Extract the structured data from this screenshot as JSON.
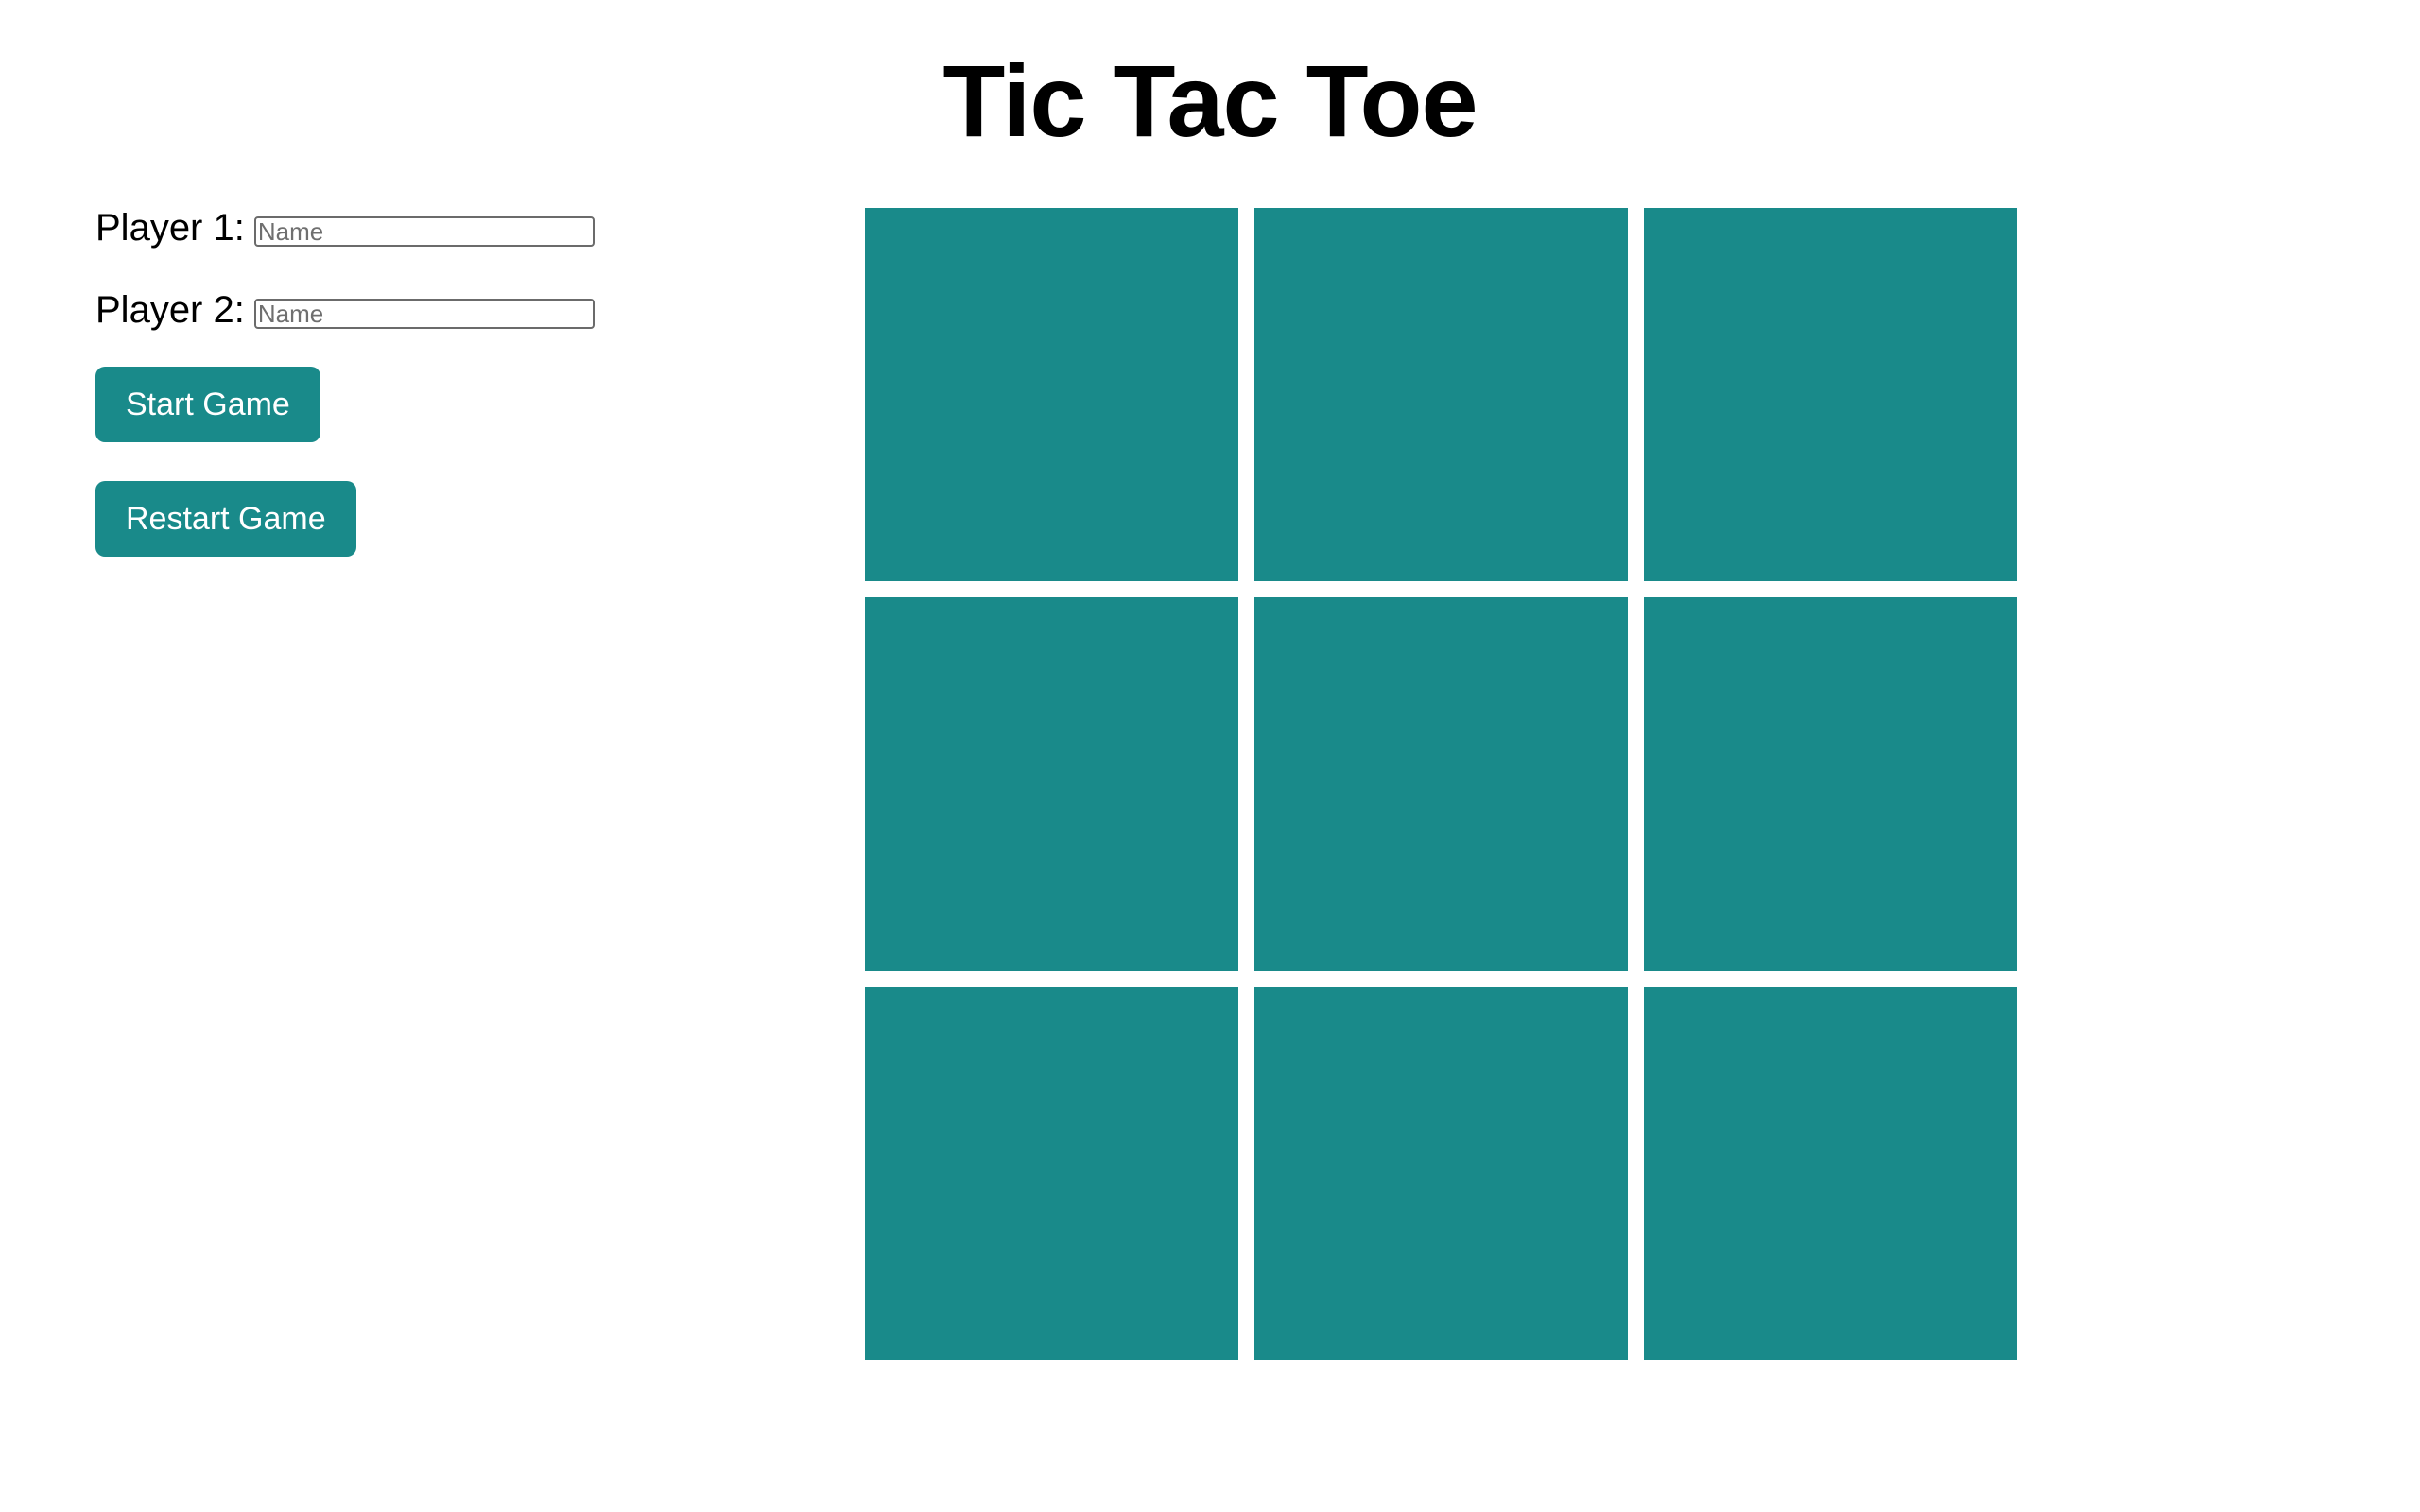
{
  "page": {
    "title": "Tic Tac Toe"
  },
  "players": [
    {
      "label": "Player 1:",
      "placeholder": "Name",
      "value": ""
    },
    {
      "label": "Player 2:",
      "placeholder": "Name",
      "value": ""
    }
  ],
  "buttons": {
    "start_label": "Start Game",
    "restart_label": "Restart Game"
  },
  "board": {
    "cells": [
      "",
      "",
      "",
      "",
      "",
      "",
      "",
      "",
      ""
    ]
  },
  "colors": {
    "accent": "#198a8a",
    "background": "#ffffff",
    "button_text": "#ffffff"
  }
}
